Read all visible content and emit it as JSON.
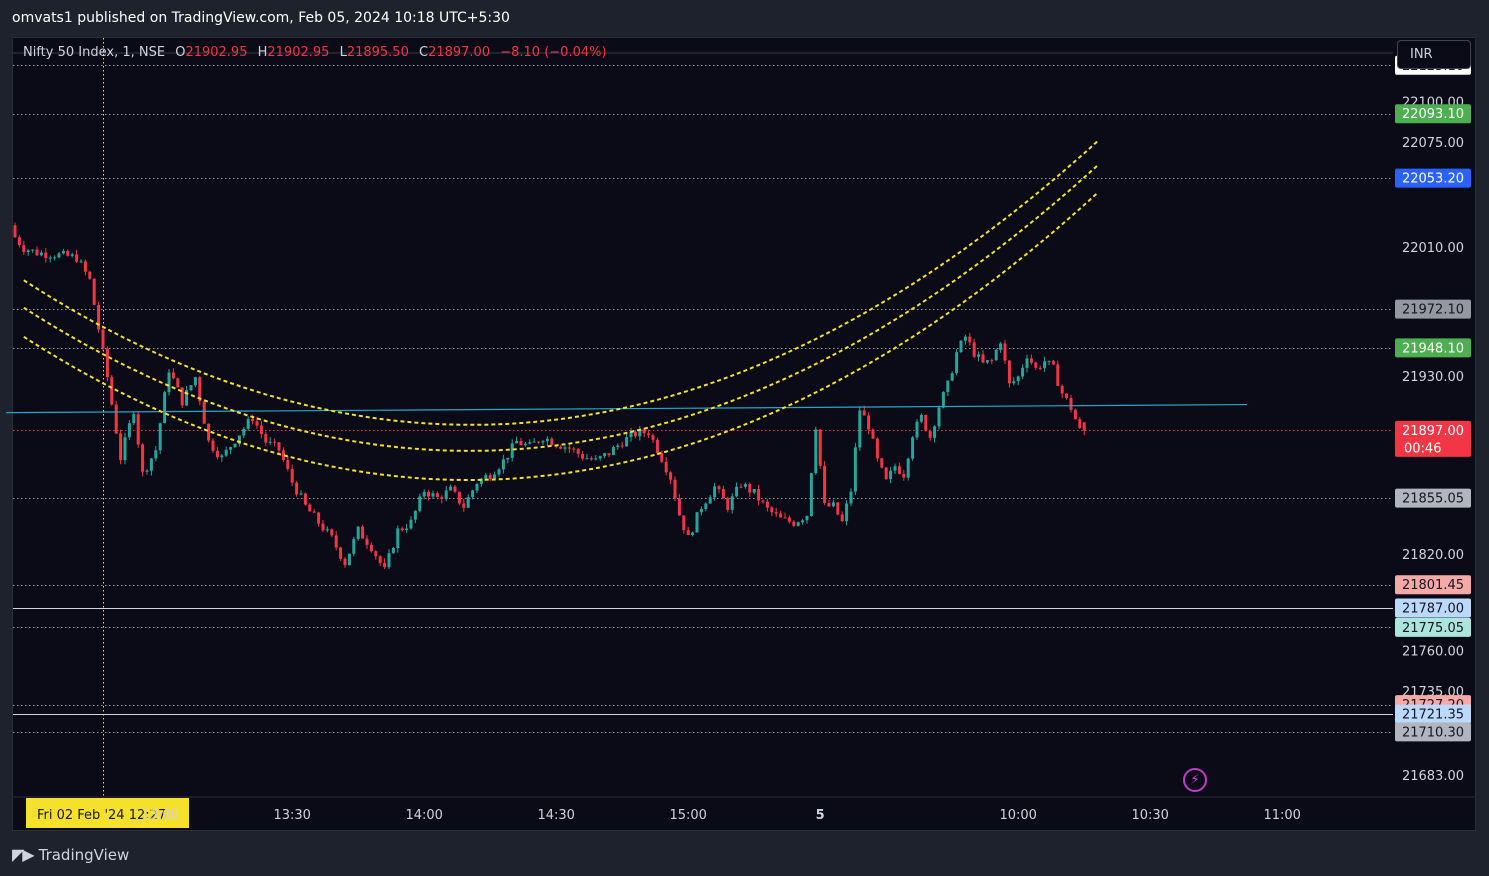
{
  "header": {
    "published": "omvats1 published on TradingView.com, Feb 05, 2024 10:18 UTC+5:30"
  },
  "legend": {
    "symbol": "Nifty 50 Index, 1, NSE",
    "o_label": "O",
    "o": "21902.95",
    "h_label": "H",
    "h": "21902.95",
    "l_label": "L",
    "l": "21895.50",
    "c_label": "C",
    "c": "21897.00",
    "change": "−8.10 (−0.04%)"
  },
  "currency_button": "INR",
  "footer": {
    "brand": "TradingView",
    "icon": "tradingview-logo-icon"
  },
  "alert_icon": "lightning-icon",
  "chart_data": {
    "type": "candlestick",
    "y_range": [
      21670,
      22140
    ],
    "y_ticks": [
      "22100.00",
      "22075.00",
      "22010.00",
      "21930.00",
      "21855.00",
      "21820.00",
      "21760.00",
      "21735.00",
      "21683.00"
    ],
    "x_ticks": [
      {
        "label": "Fri 02 Feb '24  12:27",
        "bar": 0,
        "highlight": true
      },
      {
        "label": "13:00",
        "bar": 33
      },
      {
        "label": "13:30",
        "bar": 63
      },
      {
        "label": "14:00",
        "bar": 93
      },
      {
        "label": "14:30",
        "bar": 123
      },
      {
        "label": "15:00",
        "bar": 153
      },
      {
        "label": "5",
        "bar": 183,
        "bold": true
      },
      {
        "label": "10:00",
        "bar": 228
      },
      {
        "label": "10:30",
        "bar": 258
      },
      {
        "label": "11:00",
        "bar": 288
      }
    ],
    "price_labels": [
      {
        "text": "22123.10",
        "value": 22123.1,
        "bg": "#ffffff",
        "fg": "#131722"
      },
      {
        "text": "22093.10",
        "value": 22093.1,
        "bg": "#4caf50",
        "fg": "#ffffff"
      },
      {
        "text": "22053.20",
        "value": 22053.2,
        "bg": "#2962ff",
        "fg": "#ffffff"
      },
      {
        "text": "21972.10",
        "value": 21972.1,
        "bg": "#9598a1",
        "fg": "#131722"
      },
      {
        "text": "21948.10",
        "value": 21948.1,
        "bg": "#4caf50",
        "fg": "#ffffff"
      },
      {
        "text": "21897.00",
        "value": 21897.0,
        "bg": "#f23645",
        "fg": "#ffffff",
        "sub": "00:46"
      },
      {
        "text": "21855.05",
        "value": 21855.05,
        "bg": "#b2b5be",
        "fg": "#131722"
      },
      {
        "text": "21801.45",
        "value": 21801.45,
        "bg": "#f7a9a8",
        "fg": "#131722"
      },
      {
        "text": "21787.00",
        "value": 21787.0,
        "bg": "#bbd9fb",
        "fg": "#131722"
      },
      {
        "text": "21775.05",
        "value": 21775.05,
        "bg": "#ace5dc",
        "fg": "#131722"
      },
      {
        "text": "21727.20",
        "value": 21727.2,
        "bg": "#f7a9a8",
        "fg": "#131722"
      },
      {
        "text": "21721.35",
        "value": 21721.35,
        "bg": "#bbd9fb",
        "fg": "#131722"
      },
      {
        "text": "21710.30",
        "value": 21710.3,
        "bg": "#b2b5be",
        "fg": "#131722"
      }
    ],
    "h_lines": [
      {
        "value": 22123.1,
        "style": "dotted",
        "color": "#9598a1"
      },
      {
        "value": 22093.1,
        "style": "dotted",
        "color": "#9598a1"
      },
      {
        "value": 22053.2,
        "style": "dotted",
        "color": "#9598a1"
      },
      {
        "value": 21972.1,
        "style": "dotted",
        "color": "#9598a1"
      },
      {
        "value": 21948.1,
        "style": "dotted",
        "color": "#9598a1"
      },
      {
        "value": 21855.05,
        "style": "dotted",
        "color": "#9598a1"
      },
      {
        "value": 21801.45,
        "style": "dotted",
        "color": "#9598a1"
      },
      {
        "value": 21787.0,
        "style": "solid",
        "color": "#d1d4dc"
      },
      {
        "value": 21775.05,
        "style": "dotted",
        "color": "#9598a1"
      },
      {
        "value": 21727.2,
        "style": "dotted",
        "color": "#9598a1"
      },
      {
        "value": 21721.35,
        "style": "solid",
        "color": "#d1d4dc"
      },
      {
        "value": 21710.3,
        "style": "dotted",
        "color": "#9598a1"
      },
      {
        "value": 21897.0,
        "style": "dotted",
        "color": "#f23645"
      }
    ],
    "trend_line": {
      "from": [
        -2,
        21908
      ],
      "to": [
        280,
        21913
      ],
      "color": "#26a7c9"
    },
    "curves": [
      {
        "points": [
          [
            2,
            21990
          ],
          [
            117,
            21902
          ],
          [
            246,
            22076
          ]
        ],
        "color": "#f5e12b"
      },
      {
        "points": [
          [
            2,
            21973
          ],
          [
            117,
            21886
          ],
          [
            246,
            22061
          ]
        ],
        "color": "#f5e12b"
      },
      {
        "points": [
          [
            2,
            21955
          ],
          [
            117,
            21868
          ],
          [
            246,
            22044
          ]
        ],
        "color": "#f5e12b"
      }
    ],
    "cursor_bar": 20,
    "colors": {
      "up": "#26a69a",
      "down": "#f23645"
    },
    "anchors": [
      [
        0,
        22020
      ],
      [
        3,
        22010
      ],
      [
        6,
        22007
      ],
      [
        10,
        22006
      ],
      [
        15,
        22004
      ],
      [
        18,
        21990
      ],
      [
        20,
        21960
      ],
      [
        22,
        21930
      ],
      [
        25,
        21880
      ],
      [
        28,
        21910
      ],
      [
        30,
        21870
      ],
      [
        33,
        21885
      ],
      [
        36,
        21935
      ],
      [
        39,
        21915
      ],
      [
        42,
        21930
      ],
      [
        45,
        21890
      ],
      [
        48,
        21880
      ],
      [
        52,
        21895
      ],
      [
        55,
        21905
      ],
      [
        58,
        21890
      ],
      [
        61,
        21885
      ],
      [
        64,
        21865
      ],
      [
        67,
        21850
      ],
      [
        70,
        21840
      ],
      [
        73,
        21830
      ],
      [
        76,
        21815
      ],
      [
        79,
        21835
      ],
      [
        82,
        21825
      ],
      [
        85,
        21810
      ],
      [
        88,
        21835
      ],
      [
        91,
        21840
      ],
      [
        94,
        21860
      ],
      [
        97,
        21855
      ],
      [
        100,
        21860
      ],
      [
        103,
        21850
      ],
      [
        106,
        21865
      ],
      [
        109,
        21870
      ],
      [
        112,
        21878
      ],
      [
        115,
        21890
      ],
      [
        118,
        21887
      ],
      [
        121,
        21893
      ],
      [
        124,
        21889
      ],
      [
        127,
        21886
      ],
      [
        130,
        21881
      ],
      [
        133,
        21878
      ],
      [
        136,
        21883
      ],
      [
        139,
        21890
      ],
      [
        142,
        21895
      ],
      [
        145,
        21896
      ],
      [
        148,
        21880
      ],
      [
        150,
        21868
      ],
      [
        152,
        21845
      ],
      [
        154,
        21830
      ],
      [
        157,
        21850
      ],
      [
        160,
        21862
      ],
      [
        163,
        21850
      ],
      [
        166,
        21864
      ],
      [
        169,
        21858
      ],
      [
        172,
        21848
      ],
      [
        175,
        21842
      ],
      [
        178,
        21840
      ],
      [
        181,
        21845
      ],
      [
        183,
        21900
      ],
      [
        185,
        21850
      ],
      [
        187,
        21850
      ],
      [
        189,
        21840
      ],
      [
        191,
        21860
      ],
      [
        193,
        21910
      ],
      [
        195,
        21900
      ],
      [
        197,
        21878
      ],
      [
        199,
        21865
      ],
      [
        201,
        21875
      ],
      [
        203,
        21870
      ],
      [
        205,
        21895
      ],
      [
        207,
        21905
      ],
      [
        209,
        21893
      ],
      [
        211,
        21912
      ],
      [
        213,
        21925
      ],
      [
        215,
        21945
      ],
      [
        217,
        21955
      ],
      [
        219,
        21945
      ],
      [
        221,
        21938
      ],
      [
        223,
        21940
      ],
      [
        225,
        21953
      ],
      [
        227,
        21925
      ],
      [
        229,
        21930
      ],
      [
        231,
        21944
      ],
      [
        233,
        21935
      ],
      [
        235,
        21940
      ],
      [
        237,
        21935
      ],
      [
        239,
        21920
      ],
      [
        241,
        21911
      ],
      [
        243,
        21897
      ]
    ]
  }
}
